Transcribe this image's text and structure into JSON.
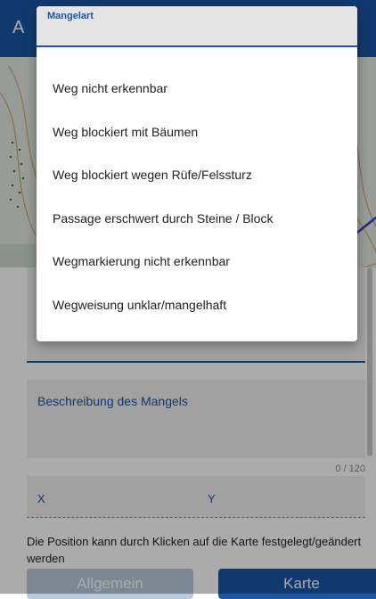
{
  "header": {
    "title_initial": "A"
  },
  "form": {
    "description_label": "Beschreibung des Mangels",
    "char_counter": "0 / 120",
    "coord_x_label": "X",
    "coord_y_label": "Y",
    "position_hint": "Die Position kann durch Klicken auf die Karte festgelegt/geändert werden"
  },
  "buttons": {
    "allgemein": "Allgemein",
    "karte": "Karte"
  },
  "dropdown": {
    "label": "Mangelart",
    "options": [
      "Weg nicht erkennbar",
      "Weg blockiert mit Bäumen",
      "Weg blockiert wegen Rüfe/Felssturz",
      "Passage erschwert durch Steine / Block",
      "Wegmarkierung nicht erkennbar",
      "Wegweisung unklar/mangelhaft"
    ]
  },
  "colors": {
    "accent": "#1b56a6",
    "scrim": "rgba(0,0,0,0.33)"
  }
}
